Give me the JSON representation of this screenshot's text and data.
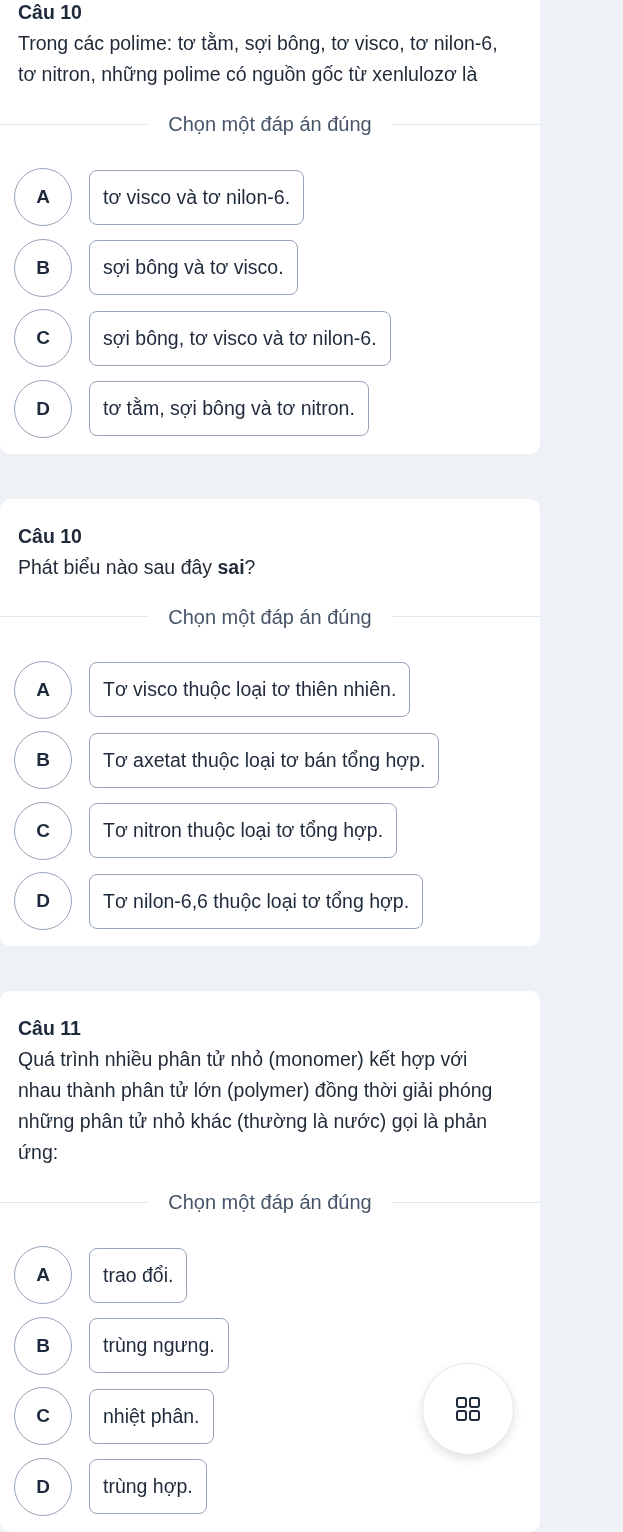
{
  "questions": [
    {
      "title": "Câu 10",
      "text": "Trong các polime: tơ tằm, sợi bông, tơ visco, tơ nilon-6, tơ nitron, những polime có nguồn gốc từ xenlulozơ là",
      "prompt": "Chọn một đáp án đúng",
      "options": [
        {
          "letter": "A",
          "text": "tơ visco và tơ nilon-6.",
          "selected": false
        },
        {
          "letter": "B",
          "text": "sợi bông và tơ visco.",
          "selected": false
        },
        {
          "letter": "C",
          "text": "sợi bông, tơ visco và tơ nilon-6.",
          "selected": false
        },
        {
          "letter": "D",
          "text": "tơ tằm, sợi bông và tơ nitron.",
          "selected": false
        }
      ]
    },
    {
      "title": "Câu 10",
      "text": "Phát biểu nào sau đây **sai**?",
      "prompt": "Chọn một đáp án đúng",
      "options": [
        {
          "letter": "A",
          "text": "Tơ visco thuộc loại tơ thiên nhiên.",
          "selected": false
        },
        {
          "letter": "B",
          "text": "Tơ axetat thuộc loại tơ bán tổng hợp.",
          "selected": false
        },
        {
          "letter": "C",
          "text": "Tơ nitron thuộc loại tơ tổng hợp.",
          "selected": false
        },
        {
          "letter": "D",
          "text": "Tơ nilon-6,6 thuộc loại tơ tổng hợp.",
          "selected": false
        }
      ]
    },
    {
      "title": "Câu 11",
      "text": "Quá trình nhiều phân tử nhỏ (monomer) kết hợp với nhau thành phân tử lớn (polymer) đồng thời giải phóng những phân tử nhỏ khác (thường là nước) gọi là phản ứng:",
      "prompt": "Chọn một đáp án đúng",
      "options": [
        {
          "letter": "A",
          "text": "trao đổi.",
          "selected": false
        },
        {
          "letter": "B",
          "text": "trùng ngưng.",
          "selected": false
        },
        {
          "letter": "C",
          "text": "nhiệt phân.",
          "selected": false
        },
        {
          "letter": "D",
          "text": "trùng hợp.",
          "selected": false
        }
      ]
    }
  ]
}
